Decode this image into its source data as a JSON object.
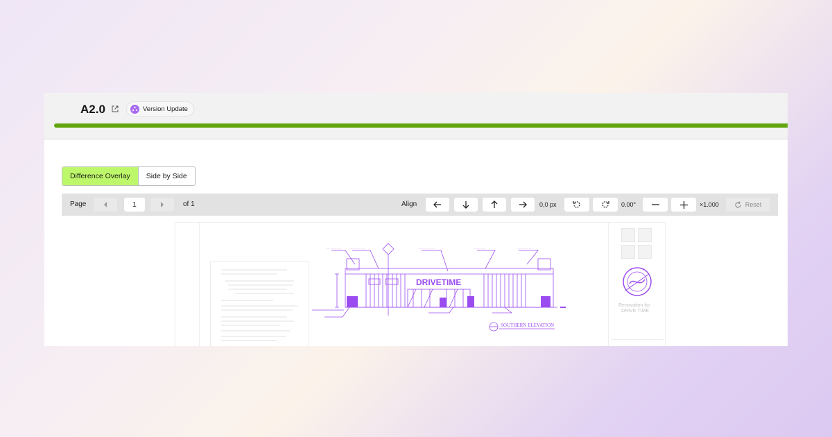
{
  "header": {
    "title": "A2.0",
    "badge_label": "Version Update",
    "progress_percent": 100,
    "progress_color": "#62a50f",
    "icons": [
      "external-link-icon",
      "version-update-icon"
    ]
  },
  "mode_toggle": {
    "options": [
      "Difference Overlay",
      "Side by Side"
    ],
    "active": "Difference Overlay",
    "active_color": "#bdf86a"
  },
  "toolbar": {
    "page_label": "Page",
    "page_value": "1",
    "page_of": "of 1",
    "align_label": "Align",
    "offset_value": "0,0 px",
    "rotation_value": "0.00°",
    "zoom_value": "×1.000",
    "reset_label": "Reset",
    "icons": [
      "chevron-left-icon",
      "chevron-right-icon",
      "arrow-left-icon",
      "arrow-down-icon",
      "arrow-up-icon",
      "arrow-right-icon",
      "rotate-ccw-icon",
      "rotate-cw-icon",
      "minus-icon",
      "plus-icon",
      "reset-icon"
    ]
  },
  "drawing": {
    "overlay_color": "#9b4cf0",
    "sign_text": "DRIVETIME",
    "sheet_title": "SOUTHERN ELEVATION",
    "right_panel_text": [
      "Renovation for",
      "DRIVE TIME"
    ]
  }
}
